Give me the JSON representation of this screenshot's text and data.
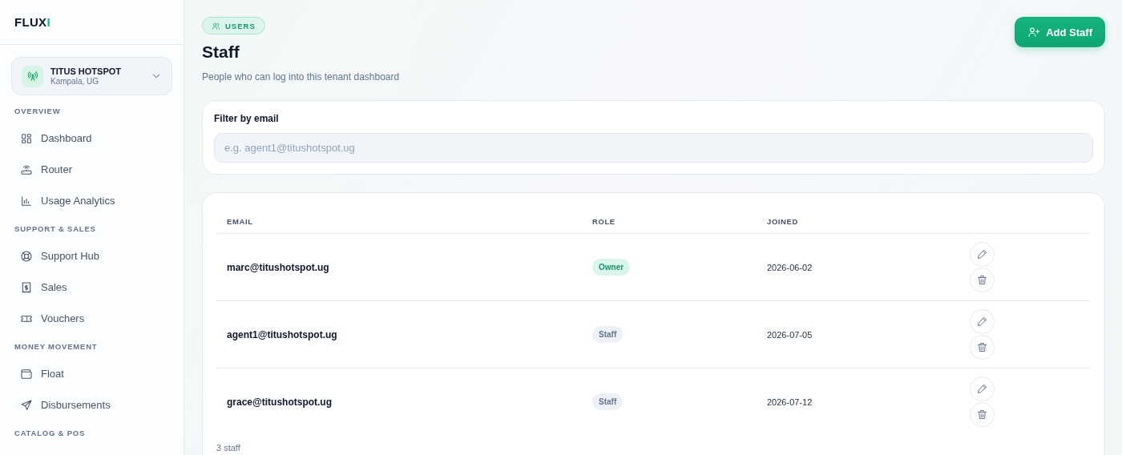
{
  "logo": {
    "text": "FLUX",
    "accent": "I"
  },
  "workspace": {
    "name": "TITUS HOTSPOT",
    "location": "Kampala, UG"
  },
  "sidebar": {
    "sections": [
      {
        "title": "OVERVIEW",
        "items": [
          {
            "label": "Dashboard"
          },
          {
            "label": "Router"
          },
          {
            "label": "Usage Analytics"
          }
        ]
      },
      {
        "title": "SUPPORT & SALES",
        "items": [
          {
            "label": "Support Hub"
          },
          {
            "label": "Sales"
          },
          {
            "label": "Vouchers"
          }
        ]
      },
      {
        "title": "MONEY MOVEMENT",
        "items": [
          {
            "label": "Float"
          },
          {
            "label": "Disbursements"
          }
        ]
      },
      {
        "title": "CATALOG & POS"
      }
    ]
  },
  "header": {
    "badge": "USERS",
    "title": "Staff",
    "subtitle": "People who can log into this tenant dashboard",
    "action": "Add Staff"
  },
  "filter": {
    "label": "Filter by email",
    "placeholder": "e.g. agent1@titushotspot.ug"
  },
  "table": {
    "columns": [
      "EMAIL",
      "ROLE",
      "JOINED"
    ],
    "rows": [
      {
        "email": "marc@titushotspot.ug",
        "role": "Owner",
        "kind": "owner",
        "joined": "2026-06-02"
      },
      {
        "email": "agent1@titushotspot.ug",
        "role": "Staff",
        "kind": "staff",
        "joined": "2026-07-05"
      },
      {
        "email": "grace@titushotspot.ug",
        "role": "Staff",
        "kind": "staff",
        "joined": "2026-07-12"
      }
    ],
    "footer": "3 staff"
  }
}
